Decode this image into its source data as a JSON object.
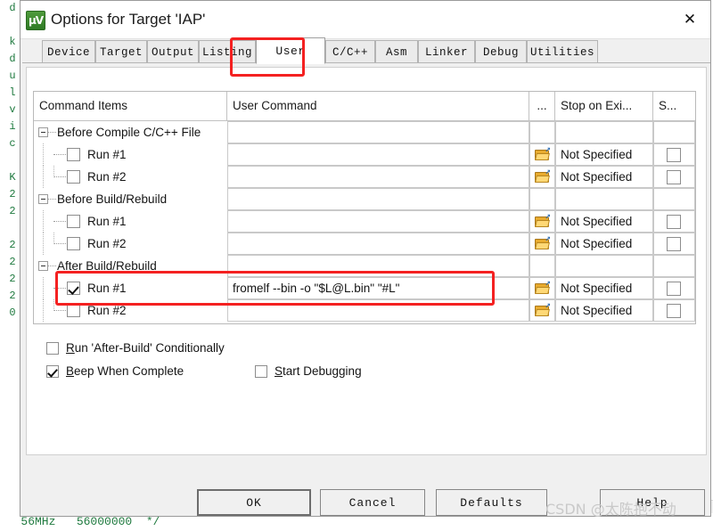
{
  "window": {
    "title": "Options for Target 'IAP'",
    "icon": "uvision-icon",
    "close_label": "✕"
  },
  "tabs": [
    {
      "label": "Device",
      "selected": false
    },
    {
      "label": "Target",
      "selected": false
    },
    {
      "label": "Output",
      "selected": false
    },
    {
      "label": "Listing",
      "selected": false
    },
    {
      "label": "User",
      "selected": true
    },
    {
      "label": "C/C++",
      "selected": false
    },
    {
      "label": "Asm",
      "selected": false
    },
    {
      "label": "Linker",
      "selected": false
    },
    {
      "label": "Debug",
      "selected": false
    },
    {
      "label": "Utilities",
      "selected": false
    }
  ],
  "grid": {
    "headers": {
      "command_items": "Command Items",
      "user_command": "User Command",
      "dots": "...",
      "stop_on_exit": "Stop on Exi...",
      "s": "S..."
    },
    "rows": [
      {
        "type": "group",
        "label": "Before Compile C/C++ File"
      },
      {
        "type": "item",
        "label": "Run #1",
        "checked": false,
        "command": "",
        "stop_on_exit": "Not Specified"
      },
      {
        "type": "item",
        "label": "Run #2",
        "checked": false,
        "command": "",
        "stop_on_exit": "Not Specified"
      },
      {
        "type": "group",
        "label": "Before Build/Rebuild"
      },
      {
        "type": "item",
        "label": "Run #1",
        "checked": false,
        "command": "",
        "stop_on_exit": "Not Specified"
      },
      {
        "type": "item",
        "label": "Run #2",
        "checked": false,
        "command": "",
        "stop_on_exit": "Not Specified"
      },
      {
        "type": "group",
        "label": "After Build/Rebuild"
      },
      {
        "type": "item",
        "label": "Run #1",
        "checked": true,
        "command": "fromelf --bin -o \"$L@L.bin\" \"#L\"",
        "stop_on_exit": "Not Specified"
      },
      {
        "type": "item",
        "label": "Run #2",
        "checked": false,
        "command": "",
        "stop_on_exit": "Not Specified"
      }
    ]
  },
  "options": [
    {
      "label_pre": "R",
      "label_post": "un 'After-Build' Conditionally",
      "checked": false
    },
    {
      "label_pre": "B",
      "label_post": "eep When Complete",
      "checked": true
    },
    {
      "label_pre": "S",
      "label_post": "tart Debugging",
      "checked": false
    }
  ],
  "buttons": [
    {
      "label": "OK",
      "default": true
    },
    {
      "label": "Cancel",
      "default": false
    },
    {
      "label": "Defaults",
      "default": false
    },
    {
      "label": "Help",
      "default": false
    }
  ],
  "background": {
    "left_code": "d\n \nk\nd\nu\nl\nv\ni\nc\n \nK\n2\n2\n \n2\n2\n2\n2\n0",
    "bottom_code": "   56MHz   56000000  */"
  },
  "watermark": "CSDN @太陈抱不动",
  "colors": {
    "annotation_red": "#f42121",
    "dialog_face": "#f0f0f0",
    "folder_yellow": "#e8ab2e",
    "code_green": "#1f7a3f"
  }
}
